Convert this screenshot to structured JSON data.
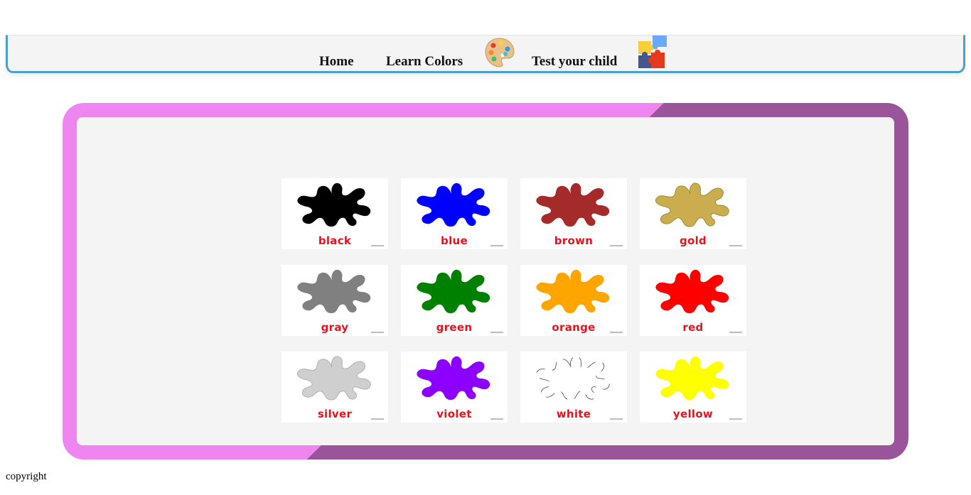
{
  "nav": {
    "home": "Home",
    "learn_colors": "Learn Colors",
    "test_child": "Test your child",
    "palette_icon": "paint-palette-icon",
    "puzzle_icon": "puzzle-pieces-icon"
  },
  "colors": [
    {
      "label": "black",
      "fill": "#000000"
    },
    {
      "label": "blue",
      "fill": "#0000ff"
    },
    {
      "label": "brown",
      "fill": "#a52a2a"
    },
    {
      "label": "gold",
      "fill": "#c9ad4f"
    },
    {
      "label": "gray",
      "fill": "#808080"
    },
    {
      "label": "green",
      "fill": "#008000"
    },
    {
      "label": "orange",
      "fill": "#ffa500"
    },
    {
      "label": "red",
      "fill": "#ff0000"
    },
    {
      "label": "silver",
      "fill": "#cfcfcf"
    },
    {
      "label": "violet",
      "fill": "#8b00ff"
    },
    {
      "label": "white",
      "fill": "#ffffff"
    },
    {
      "label": "yellow",
      "fill": "#ffff00"
    }
  ],
  "theme": {
    "frame_light": "#ef86ef",
    "frame_dark": "#9a5499",
    "nav_border": "#4aa0c8",
    "label_color": "#e8111d"
  },
  "footer": {
    "text": "copyright"
  }
}
